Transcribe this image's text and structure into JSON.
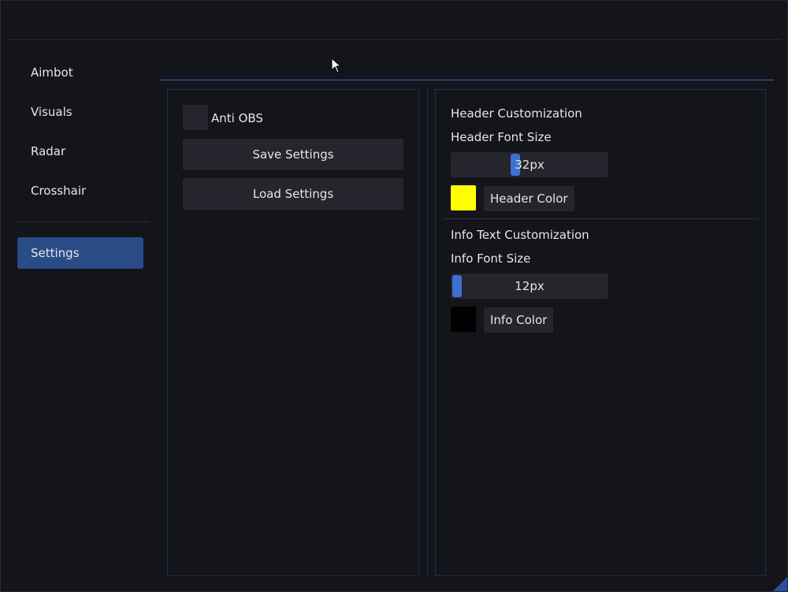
{
  "sidebar": {
    "items": [
      {
        "label": "Aimbot"
      },
      {
        "label": "Visuals"
      },
      {
        "label": "Radar"
      },
      {
        "label": "Crosshair"
      },
      {
        "label": "Settings",
        "active": true
      }
    ]
  },
  "left_panel": {
    "anti_obs": {
      "label": "Anti OBS",
      "checked": false
    },
    "save_label": "Save Settings",
    "load_label": "Load Settings"
  },
  "right_panel": {
    "header_section": {
      "title": "Header Customization",
      "font_size_label": "Header Font Size",
      "font_size_value": "32px",
      "font_size_fraction": 0.4,
      "color_label": "Header Color",
      "color": "#ffff00"
    },
    "info_section": {
      "title": "Info Text Customization",
      "font_size_label": "Info Font Size",
      "font_size_value": "12px",
      "font_size_fraction": 0.0,
      "color_label": "Info Color",
      "color": "#000000"
    }
  },
  "theme": {
    "accent": "#294c86",
    "slider_handle": "#3f6fd0"
  }
}
